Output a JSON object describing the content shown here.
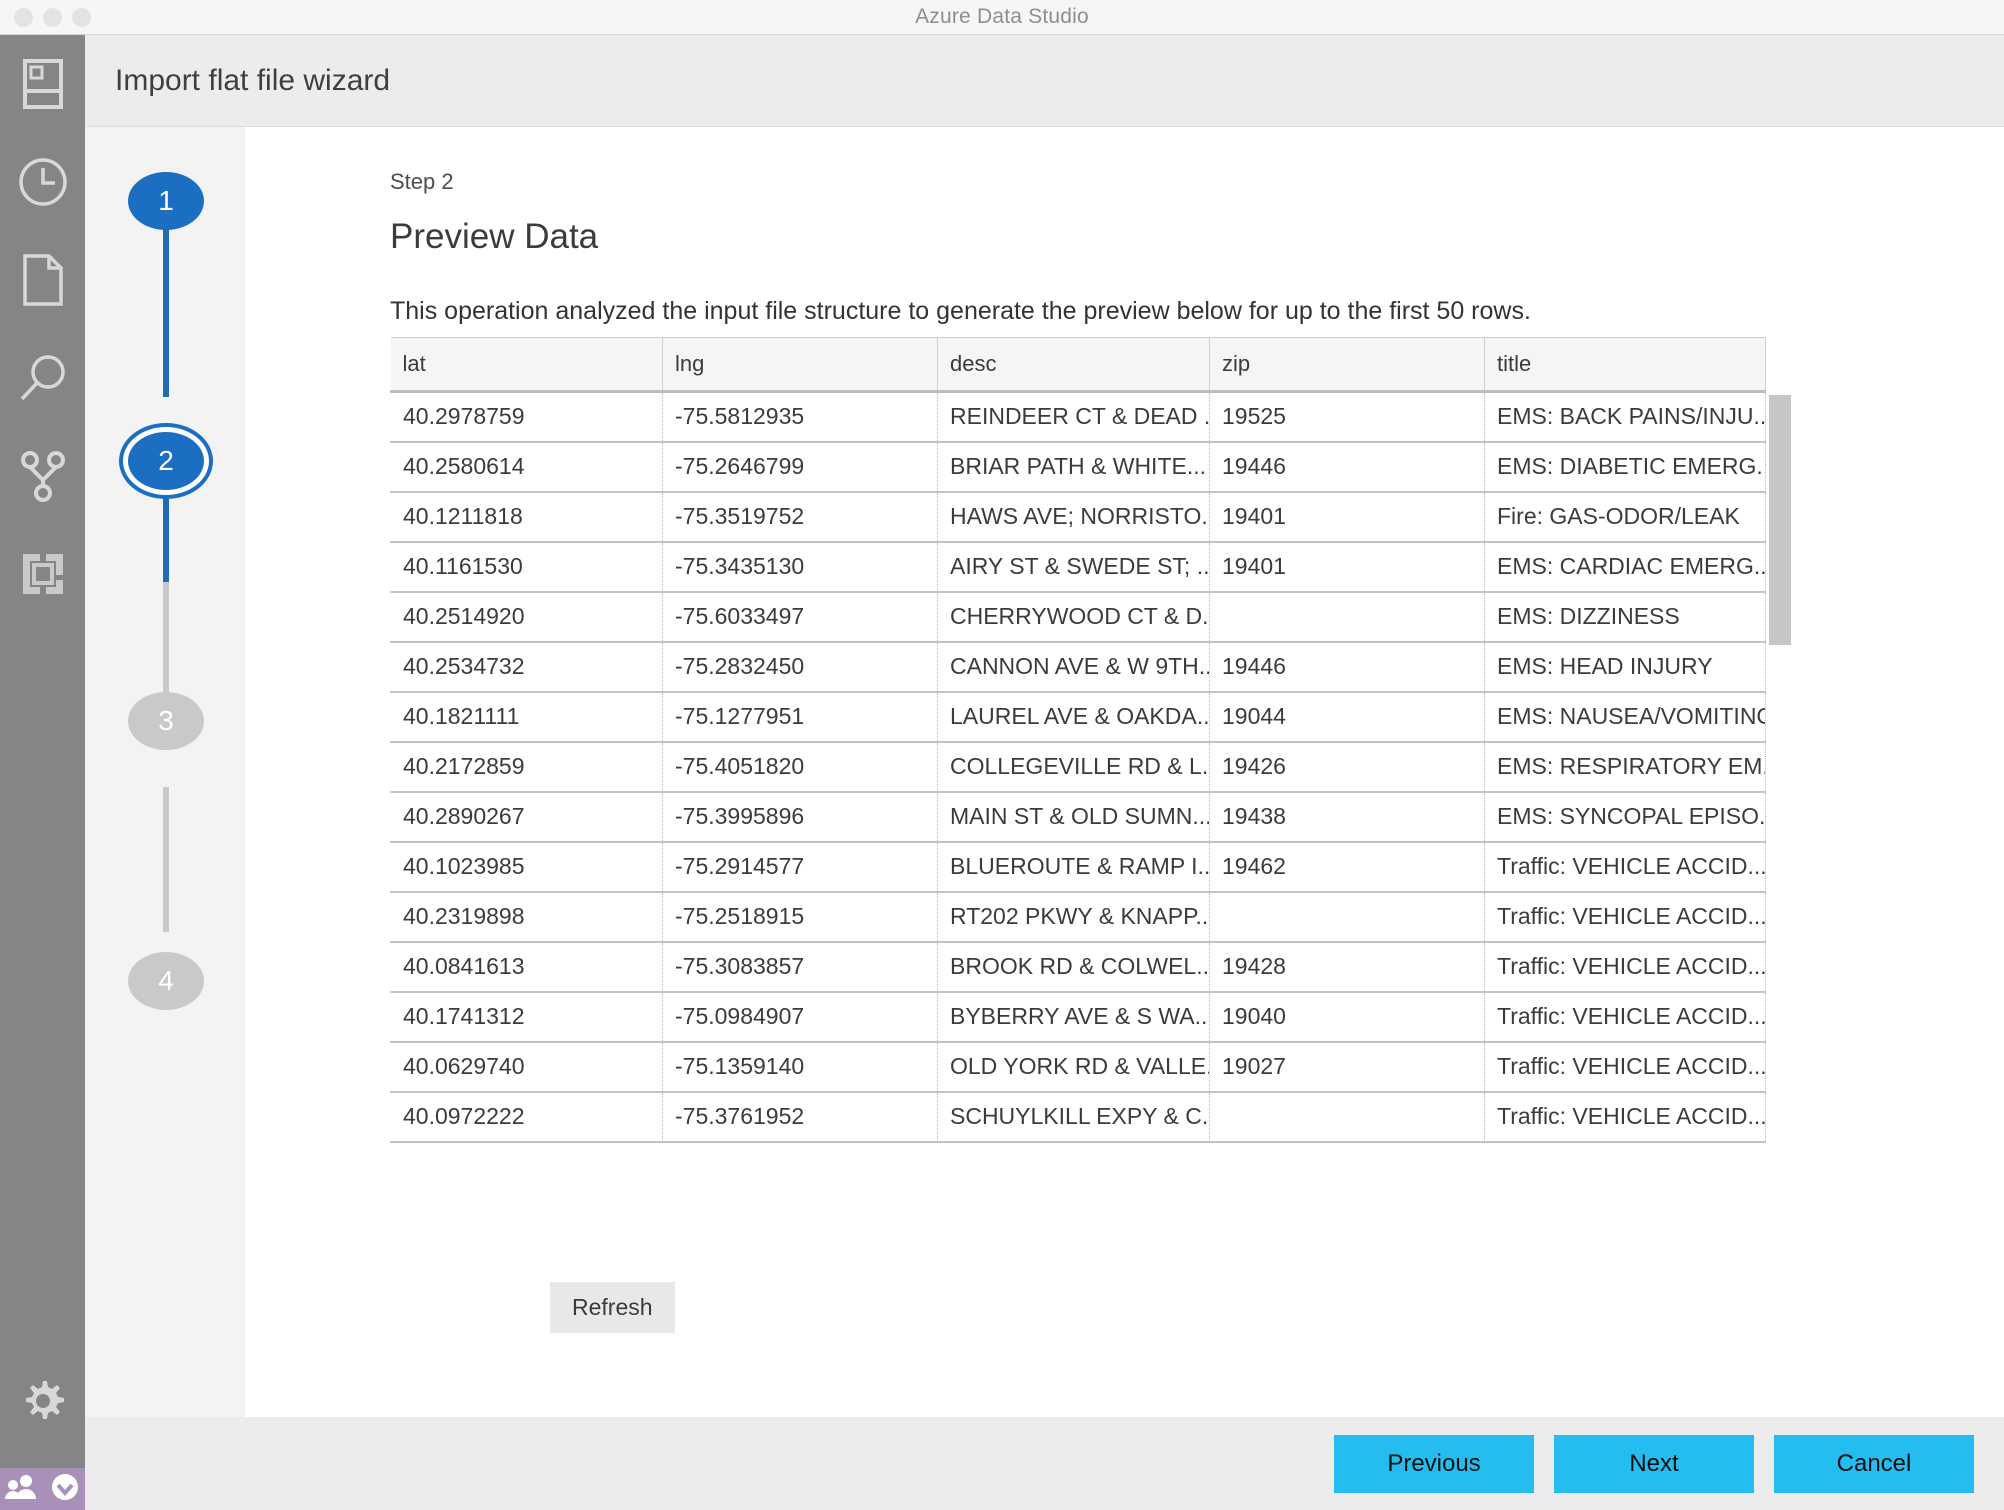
{
  "window": {
    "title": "Azure Data Studio",
    "traffic_lights": [
      "close",
      "minimize",
      "zoom"
    ]
  },
  "activitybar": {
    "icons": [
      {
        "name": "servers-icon",
        "label": "Servers"
      },
      {
        "name": "history-icon",
        "label": "History"
      },
      {
        "name": "file-icon",
        "label": "Explorer"
      },
      {
        "name": "search-icon",
        "label": "Search"
      },
      {
        "name": "source-control-icon",
        "label": "Source Control"
      },
      {
        "name": "extensions-icon",
        "label": "Extensions"
      }
    ],
    "bottom_icons": [
      {
        "name": "gear-icon",
        "label": "Manage"
      },
      {
        "name": "accounts-icon",
        "label": "Accounts"
      },
      {
        "name": "sync-check-icon",
        "label": "Settings Sync"
      }
    ]
  },
  "wizard": {
    "header_title": "Import flat file wizard",
    "step_label": "Step 2",
    "page_title": "Preview Data",
    "description": "This operation analyzed the input file structure to generate the preview below for up to the first 50 rows.",
    "refresh_label": "Refresh",
    "steps": [
      {
        "number": "1",
        "state": "done"
      },
      {
        "number": "2",
        "state": "current"
      },
      {
        "number": "3",
        "state": "pending"
      },
      {
        "number": "4",
        "state": "pending"
      }
    ]
  },
  "table": {
    "columns": [
      "lat",
      "lng",
      "desc",
      "zip",
      "title"
    ],
    "rows": [
      [
        "40.2978759",
        "-75.5812935",
        "REINDEER CT & DEAD ...",
        "19525",
        "EMS: BACK PAINS/INJU..."
      ],
      [
        "40.2580614",
        "-75.2646799",
        "BRIAR PATH & WHITE...",
        "19446",
        "EMS: DIABETIC EMERG..."
      ],
      [
        "40.1211818",
        "-75.3519752",
        "HAWS AVE; NORRISTO...",
        "19401",
        "Fire: GAS-ODOR/LEAK"
      ],
      [
        "40.1161530",
        "-75.3435130",
        "AIRY ST & SWEDE ST; ...",
        "19401",
        "EMS: CARDIAC EMERG..."
      ],
      [
        "40.2514920",
        "-75.6033497",
        "CHERRYWOOD CT & D...",
        "",
        "EMS: DIZZINESS"
      ],
      [
        "40.2534732",
        "-75.2832450",
        "CANNON AVE & W 9TH...",
        "19446",
        "EMS: HEAD INJURY"
      ],
      [
        "40.1821111",
        "-75.1277951",
        "LAUREL AVE & OAKDA...",
        "19044",
        "EMS: NAUSEA/VOMITING"
      ],
      [
        "40.2172859",
        "-75.4051820",
        "COLLEGEVILLE RD & L...",
        "19426",
        "EMS: RESPIRATORY EM..."
      ],
      [
        "40.2890267",
        "-75.3995896",
        "MAIN ST & OLD SUMN...",
        "19438",
        "EMS: SYNCOPAL EPISO..."
      ],
      [
        "40.1023985",
        "-75.2914577",
        "BLUEROUTE & RAMP I...",
        "19462",
        "Traffic: VEHICLE ACCID..."
      ],
      [
        "40.2319898",
        "-75.2518915",
        "RT202 PKWY & KNAPP...",
        "",
        "Traffic: VEHICLE ACCID..."
      ],
      [
        "40.0841613",
        "-75.3083857",
        "BROOK RD & COLWEL...",
        "19428",
        "Traffic: VEHICLE ACCID..."
      ],
      [
        "40.1741312",
        "-75.0984907",
        "BYBERRY AVE & S WA...",
        "19040",
        "Traffic: VEHICLE ACCID..."
      ],
      [
        "40.0629740",
        "-75.1359140",
        "OLD YORK RD & VALLE...",
        "19027",
        "Traffic: VEHICLE ACCID..."
      ],
      [
        "40.0972222",
        "-75.3761952",
        "SCHUYLKILL EXPY & C...",
        "",
        "Traffic: VEHICLE ACCID..."
      ]
    ]
  },
  "footer": {
    "previous_label": "Previous",
    "next_label": "Next",
    "cancel_label": "Cancel"
  },
  "colors": {
    "accent_blue": "#1b6ec2",
    "button_cyan": "#25bdef",
    "activitybar_grey": "#858585",
    "account_purple": "#a990b8"
  }
}
